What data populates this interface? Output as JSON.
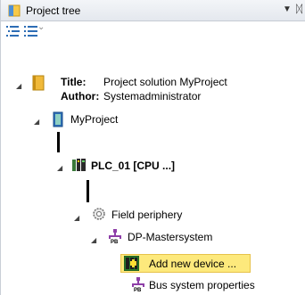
{
  "window": {
    "title": "Project tree",
    "menu_glyph": "▼",
    "pin_glyph": "ᛞ"
  },
  "toolbar": {
    "more_glyph": "⌄"
  },
  "project": {
    "title_label": "Title:",
    "title_value": "Project solution MyProject",
    "author_label": "Author:",
    "author_value": "Systemadministrator"
  },
  "tree": {
    "expand_glyph": "◢",
    "nodes": {
      "myproject": "MyProject",
      "plc": "PLC_01 [CPU ...]",
      "field_periphery": "Field periphery",
      "dp_master": "DP-Mastersystem",
      "add_device": "Add new device ...",
      "bus_props": "Bus system properties"
    }
  },
  "colors": {
    "highlight": "#fde97c",
    "folder": "#f0b93a",
    "accent": "#2d6db5"
  }
}
